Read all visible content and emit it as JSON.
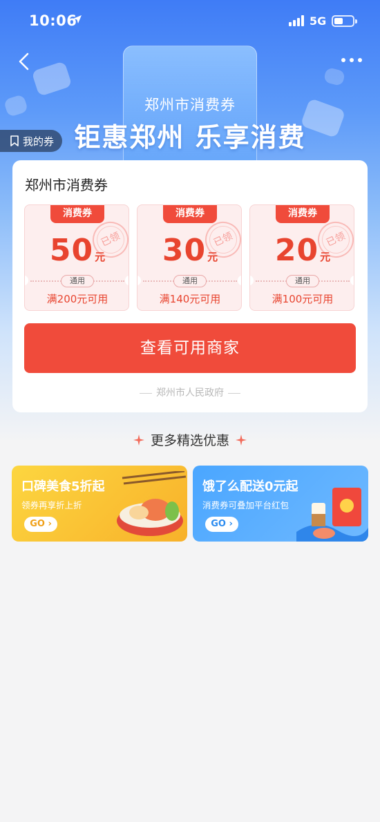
{
  "status_bar": {
    "time": "10:06",
    "network": "5G"
  },
  "hero": {
    "subtitle": "郑州市消费券",
    "title": "钜惠郑州 乐享消费",
    "my_coupons_label": "我的券"
  },
  "card": {
    "title": "郑州市消费券",
    "coupons": [
      {
        "tag": "消费券",
        "amount": "50",
        "unit": "元",
        "status": "已领",
        "scope": "通用",
        "condition": "满200元可用"
      },
      {
        "tag": "消费券",
        "amount": "30",
        "unit": "元",
        "status": "已领",
        "scope": "通用",
        "condition": "满140元可用"
      },
      {
        "tag": "消费券",
        "amount": "20",
        "unit": "元",
        "status": "已领",
        "scope": "通用",
        "condition": "满100元可用"
      }
    ],
    "primary_button": "查看可用商家",
    "issuer": "郑州市人民政府"
  },
  "more_offers": {
    "title": "更多精选优惠",
    "promos": [
      {
        "title": "口碑美食5折起",
        "subtitle": "领券再享折上折",
        "cta": "GO"
      },
      {
        "title": "饿了么配送0元起",
        "subtitle": "消费券可叠加平台红包",
        "cta": "GO"
      }
    ]
  },
  "colors": {
    "accent_red": "#f04b3b",
    "hero_blue": "#3f7cf6",
    "food_yellow": "#fcd640",
    "eleme_blue": "#4aa6ff"
  },
  "icons": [
    "location-arrow-icon",
    "signal-icon",
    "battery-icon",
    "back-arrow-icon",
    "more-dots-icon",
    "bookmark-icon",
    "sparkle-icon",
    "chevron-right-icon"
  ]
}
